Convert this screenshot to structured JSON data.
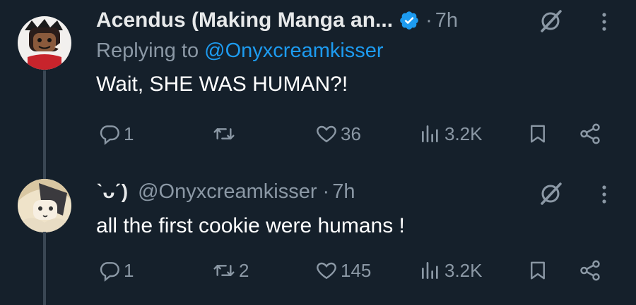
{
  "colors": {
    "background": "#15202b",
    "accent": "#1d9bf0",
    "muted": "#8b98a5",
    "thread_line": "#3a4754"
  },
  "tweets": [
    {
      "display_name": "Acendus (Making Manga an...",
      "verified": true,
      "time": "7h",
      "separator": "·",
      "replying_prefix": "Replying to",
      "replying_to": "@Onyxcreamkisser",
      "text": "Wait, SHE WAS HUMAN?!",
      "actions": {
        "reply_count": "1",
        "retweet_count": "",
        "like_count": "36",
        "views_count": "3.2K"
      },
      "icons": [
        "grok-icon",
        "more-icon",
        "reply-icon",
        "retweet-icon",
        "like-icon",
        "views-icon",
        "bookmark-icon",
        "share-icon"
      ]
    },
    {
      "emoticon": "ˋᴗˊ)",
      "handle": "@Onyxcreamkisser",
      "separator": "·",
      "time": "7h",
      "text": "all the first cookie were humans !",
      "actions": {
        "reply_count": "1",
        "retweet_count": "2",
        "like_count": "145",
        "views_count": "3.2K"
      }
    }
  ]
}
